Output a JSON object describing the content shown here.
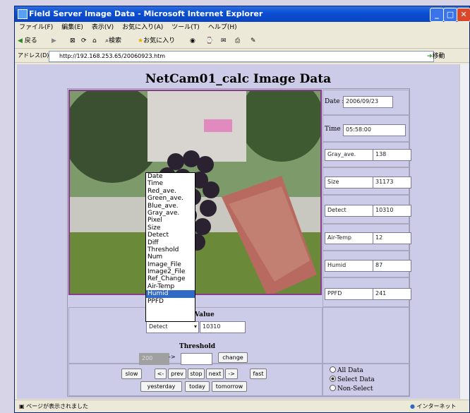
{
  "window": {
    "title": "Field Server Image Data - Microsoft Internet Explorer"
  },
  "menu": [
    "ファイル(F)",
    "編集(E)",
    "表示(V)",
    "お気に入り(A)",
    "ツール(T)",
    "ヘルプ(H)"
  ],
  "toolbar": {
    "back": "戻る",
    "search": "検索",
    "favorites": "お気に入り"
  },
  "address": {
    "label": "アドレス(D)",
    "url": "http://192.168.253.65/20060923.htm",
    "go": "移動"
  },
  "page": {
    "title": "NetCam01_calc Image Data"
  },
  "info": {
    "date_label": "Date :",
    "date_value": "2006/09/23",
    "time_label": "Time :",
    "time_value": "05:58:00",
    "rows": [
      {
        "name": "Gray_ave.",
        "value": "138"
      },
      {
        "name": "Size",
        "value": "31173"
      },
      {
        "name": "Detect",
        "value": "10310"
      },
      {
        "name": "Air-Temp",
        "value": "12"
      },
      {
        "name": "Humid",
        "value": "87"
      },
      {
        "name": "PPFD",
        "value": "241"
      }
    ]
  },
  "dropdown": {
    "options": [
      "Date",
      "Time",
      "Red_ave.",
      "Green_ave.",
      "Blue_ave.",
      "Gray_ave.",
      "Pixel",
      "Size",
      "Detect",
      "Diff",
      "Threshold",
      "Num",
      "Image_File",
      "Image2_File",
      "Ref_Change",
      "Air-Temp",
      "Humid",
      "PPFD"
    ],
    "highlighted": "Humid",
    "selected": "Detect",
    "value_label": "Value",
    "value": "10310"
  },
  "threshold": {
    "label": "Threshold",
    "value": "200",
    "arrow": "->",
    "change": "change"
  },
  "nav": {
    "slow": "slow",
    "back": "<-",
    "prev": "prev",
    "stop": "stop",
    "next": "next",
    "forward": "->",
    "fast": "fast",
    "yesterday": "yesterday",
    "today": "today",
    "tomorrow": "tomorrow"
  },
  "mode": {
    "all": "All Data",
    "select": "Select Data",
    "nonselect": "Non-Select",
    "checked": "select"
  },
  "status": {
    "left": "ページが表示されました",
    "right": "インターネット"
  }
}
